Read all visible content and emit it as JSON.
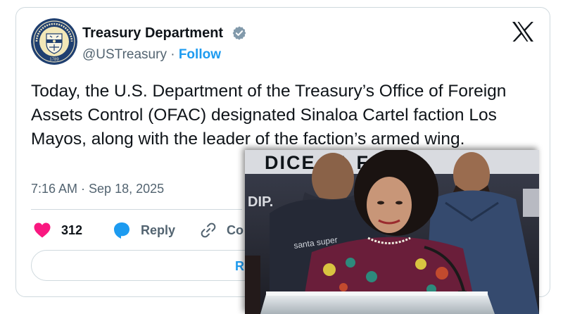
{
  "author": {
    "name": "Treasury Department",
    "handle": "@USTreasury",
    "separator": " · ",
    "follow_label": "Follow",
    "verified_color": "#829aab",
    "seal_text": "THE DEPARTMENT OF THE TREASURY",
    "seal_year": "1789"
  },
  "platform_icon": "x-logo-icon",
  "tweet": {
    "text": "Today, the U.S. Department of the Treasury’s Office of Foreign Assets Control (OFAC) designated Sinaloa Cartel faction Los Mayos, along with the leader of the faction’s armed wing.",
    "timestamp": "7:16 AM · Sep 18, 2025"
  },
  "actions": {
    "likes_count": "312",
    "reply_label": "Reply",
    "copy_label": "Co",
    "read_replies_label": "R"
  },
  "photo": {
    "banner_text": "DICE LA FAT",
    "banner_text_2": "DIP.",
    "shirt_text": "santa super"
  },
  "colors": {
    "accent": "#1d9bf0",
    "like": "#f91880",
    "muted": "#536471"
  }
}
